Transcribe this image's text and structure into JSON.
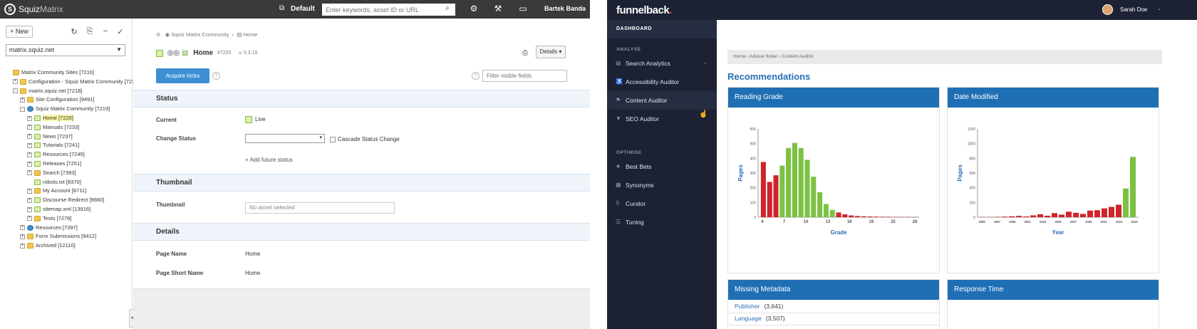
{
  "squiz": {
    "brand_a": "Squiz",
    "brand_b": "Matrix",
    "default_label": "Default",
    "search_placeholder": "Enter keywords, asset ID or URL",
    "user": "Bartek Banda",
    "new_button": "New",
    "site_select": "matrix.squiz.net",
    "tree": [
      {
        "label": "Matrix Community Sites [7216]",
        "depth": 0,
        "icon": "folder",
        "pm": ""
      },
      {
        "label": "Configuration - Squiz Matrix Community [7217]",
        "depth": 1,
        "icon": "folder",
        "pm": "+"
      },
      {
        "label": "matrix.squiz.net [7218]",
        "depth": 1,
        "icon": "folder",
        "pm": "-"
      },
      {
        "label": "Site Configuration [9491]",
        "depth": 2,
        "icon": "folder",
        "pm": "+"
      },
      {
        "label": "Squiz Matrix Community [7219]",
        "depth": 2,
        "icon": "globe",
        "pm": "-"
      },
      {
        "label": "Home [7220]",
        "depth": 3,
        "icon": "page",
        "pm": "+",
        "highlight": true
      },
      {
        "label": "Manuals [7233]",
        "depth": 3,
        "icon": "page",
        "pm": "+"
      },
      {
        "label": "News [7237]",
        "depth": 3,
        "icon": "page",
        "pm": "+"
      },
      {
        "label": "Tutorials [7241]",
        "depth": 3,
        "icon": "page",
        "pm": "+"
      },
      {
        "label": "Resources [7245]",
        "depth": 3,
        "icon": "page",
        "pm": "+"
      },
      {
        "label": "Releases [7251]",
        "depth": 3,
        "icon": "page",
        "pm": "+"
      },
      {
        "label": "Search [7393]",
        "depth": 3,
        "icon": "folder",
        "pm": "+"
      },
      {
        "label": "robots.txt [8370]",
        "depth": 3,
        "icon": "page",
        "pm": ""
      },
      {
        "label": "My Account [8711]",
        "depth": 3,
        "icon": "folder",
        "pm": "+"
      },
      {
        "label": "Discourse Redirect [9660]",
        "depth": 3,
        "icon": "page",
        "pm": "+"
      },
      {
        "label": "sitemap.xml [13916]",
        "depth": 3,
        "icon": "page",
        "pm": "+"
      },
      {
        "label": "Tests [7278]",
        "depth": 3,
        "icon": "folder",
        "pm": "+"
      },
      {
        "label": "Resources [7397]",
        "depth": 2,
        "icon": "globe",
        "pm": "+"
      },
      {
        "label": "Form Submissions [9412]",
        "depth": 2,
        "icon": "folder",
        "pm": "+"
      },
      {
        "label": "Archived [12110]",
        "depth": 2,
        "icon": "folder",
        "pm": "+"
      }
    ],
    "breadcrumb": [
      "Squiz Matrix Community",
      "Home"
    ],
    "asset_title": "Home",
    "asset_id": "#7220",
    "asset_version": "v. 0.3.15",
    "details_button": "Details",
    "acquire_button": "Acquire locks",
    "filter_placeholder": "Filter visible fields",
    "sections": {
      "status": "Status",
      "thumbnail": "Thumbnail",
      "details": "Details"
    },
    "fields": {
      "current_label": "Current",
      "current_value": "Live",
      "change_status_label": "Change Status",
      "cascade_label": "Cascade Status Change",
      "add_future": "Add future status",
      "thumbnail_label": "Thumbnail",
      "thumbnail_value": "No asset selected",
      "page_name_label": "Page Name",
      "page_name_value": "Home",
      "page_short_label": "Page Short Name",
      "page_short_value": "Home"
    }
  },
  "funnelback": {
    "logo_a": "funnelback",
    "logo_dot": ".",
    "user": "Sarah Doe",
    "dashboard": "DASHBOARD",
    "analyse_heading": "ANALYSE",
    "analyse_items": [
      "Search Analytics",
      "Accessibility Auditor",
      "Content Auditor",
      "SEO Auditor"
    ],
    "optimise_heading": "OPTIMISE",
    "optimise_items": [
      "Best Bets",
      "Synonyms",
      "Curator",
      "Tuning"
    ],
    "breadcrumb": "Home  ›  Advisor finder  ›  Content Auditor",
    "page_heading": "Recommendations",
    "panels": {
      "reading_grade": "Reading Grade",
      "date_modified": "Date Modified",
      "missing_metadata": "Missing Metadata",
      "response_time": "Response Time"
    },
    "missing_metadata": [
      {
        "field": "Publisher",
        "count": "(3,641)"
      },
      {
        "field": "Language",
        "count": "(3,507)"
      }
    ],
    "colors": {
      "red": "#d0232b",
      "green": "#7cc242",
      "blue": "#1f6fb5"
    }
  },
  "chart_data": [
    {
      "type": "bar",
      "title": "Reading Grade",
      "xlabel": "Grade",
      "ylabel": "Pages",
      "ylim": [
        0,
        600
      ],
      "yticks": [
        "0",
        "100",
        "200",
        "300",
        "400",
        "500",
        "600"
      ],
      "xticks": [
        "6",
        "7",
        "10",
        "13",
        "16",
        "19",
        "22",
        "28"
      ],
      "values": [
        375,
        240,
        285,
        350,
        470,
        505,
        470,
        390,
        275,
        170,
        90,
        50,
        32,
        20,
        12,
        8,
        6,
        5,
        4,
        3,
        3,
        2,
        2,
        2,
        1
      ],
      "colors": [
        "red",
        "red",
        "red",
        "green",
        "green",
        "green",
        "green",
        "green",
        "green",
        "green",
        "green",
        "green",
        "red",
        "red",
        "red",
        "red",
        "red",
        "red",
        "red",
        "red",
        "red",
        "red",
        "red",
        "red",
        "red"
      ]
    },
    {
      "type": "bar",
      "title": "Date Modified",
      "xlabel": "Year",
      "ylabel": "Pages",
      "ylim": [
        0,
        1200
      ],
      "yticks": [
        "0",
        "200",
        "400",
        "600",
        "800",
        "1000",
        "1200"
      ],
      "xticks": [
        "1995",
        "1997",
        "1999",
        "2001",
        "2003",
        "2005",
        "2007",
        "2009",
        "2011",
        "2013",
        "2015"
      ],
      "values": [
        2,
        3,
        5,
        8,
        12,
        18,
        10,
        25,
        40,
        20,
        55,
        35,
        75,
        60,
        45,
        90,
        95,
        120,
        140,
        170,
        390,
        820
      ],
      "colors": [
        "red",
        "red",
        "red",
        "red",
        "red",
        "red",
        "red",
        "red",
        "red",
        "red",
        "red",
        "red",
        "red",
        "red",
        "red",
        "red",
        "red",
        "red",
        "red",
        "red",
        "green",
        "green"
      ]
    }
  ]
}
